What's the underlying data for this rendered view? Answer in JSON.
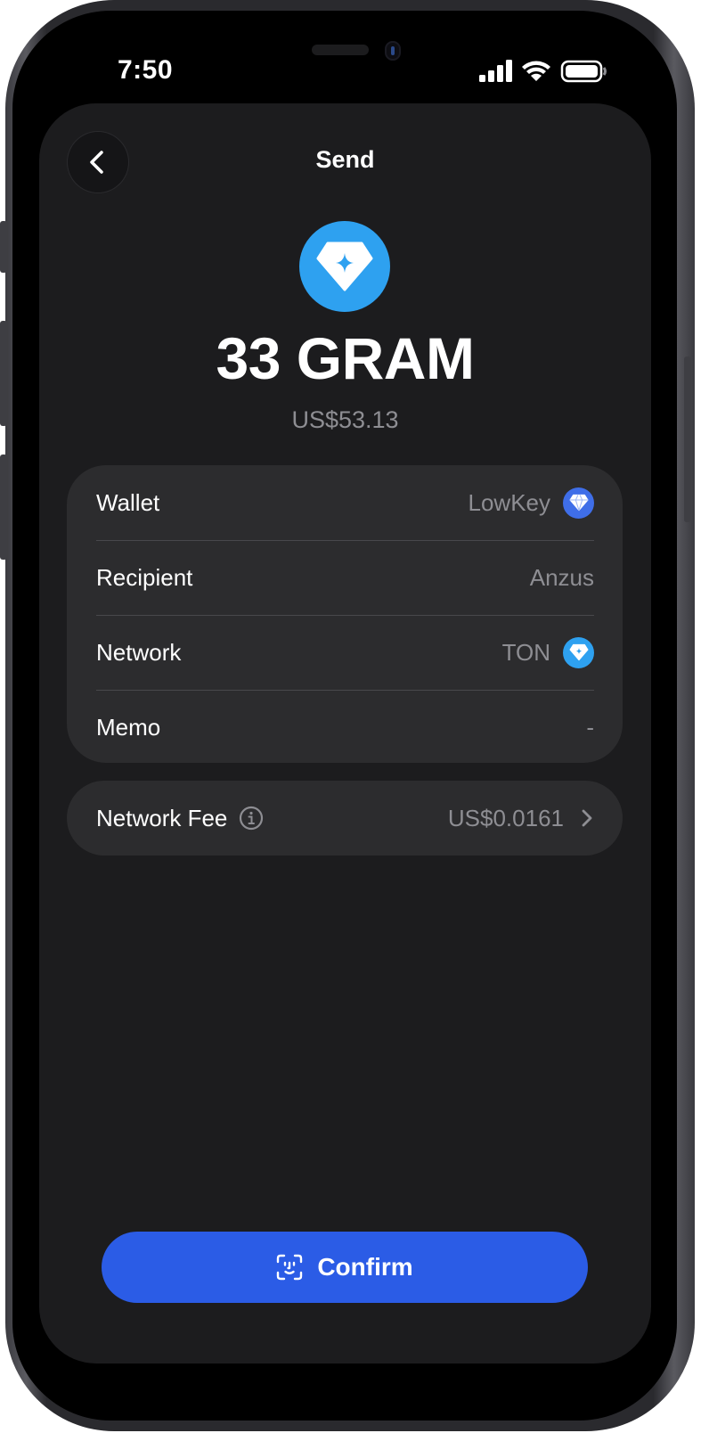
{
  "status_bar": {
    "time": "7:50",
    "icons": [
      "cellular-signal-icon",
      "wifi-icon",
      "battery-icon"
    ]
  },
  "header": {
    "title": "Send",
    "back_icon": "chevron-left-icon"
  },
  "token": {
    "icon": "gram-diamond-icon",
    "amount": "33 GRAM",
    "fiat_value": "US$53.13",
    "color": "#2ea1f0"
  },
  "details": {
    "wallet": {
      "label": "Wallet",
      "value": "LowKey",
      "icon": "wallet-diamond-icon",
      "icon_color": "#3f6ee8"
    },
    "recipient": {
      "label": "Recipient",
      "value": "Anzus"
    },
    "network": {
      "label": "Network",
      "value": "TON",
      "icon": "ton-icon",
      "icon_color": "#2ea1f0"
    },
    "memo": {
      "label": "Memo",
      "value": "-"
    }
  },
  "fee": {
    "label": "Network Fee",
    "value": "US$0.0161",
    "info_icon": "info-icon",
    "chevron_icon": "chevron-right-icon"
  },
  "confirm": {
    "label": "Confirm",
    "icon": "face-id-icon",
    "color": "#2b5ce6"
  },
  "colors": {
    "background": "#1c1c1e",
    "card": "#2c2c2e",
    "secondary_text": "#8e8e93"
  }
}
